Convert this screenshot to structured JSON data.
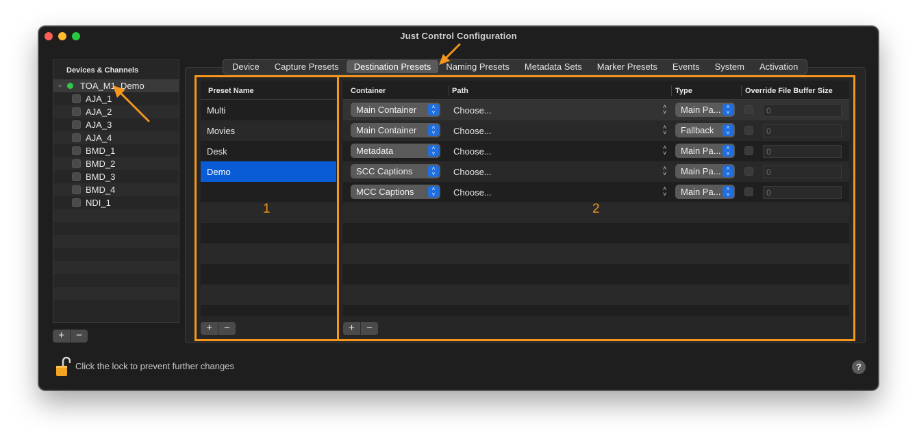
{
  "window": {
    "title": "Just Control Configuration"
  },
  "sidebar": {
    "header": "Devices & Channels",
    "device": {
      "label": "TOA_M1_Demo",
      "status_color": "#33c749"
    },
    "channels": [
      "AJA_1",
      "AJA_2",
      "AJA_3",
      "AJA_4",
      "BMD_1",
      "BMD_2",
      "BMD_3",
      "BMD_4",
      "NDI_1"
    ],
    "add_label": "+",
    "remove_label": "−"
  },
  "tabs": {
    "items": [
      "Device",
      "Capture Presets",
      "Destination Presets",
      "Naming Presets",
      "Metadata Sets",
      "Marker Presets",
      "Events",
      "System",
      "Activation"
    ],
    "active": "Destination Presets"
  },
  "presets": {
    "header": "Preset Name",
    "items": [
      "Multi",
      "Movies",
      "Desk",
      "Demo"
    ],
    "selected": "Demo",
    "add_label": "+",
    "remove_label": "−"
  },
  "containers": {
    "headers": {
      "container": "Container",
      "path": "Path",
      "type": "Type",
      "override": "Override File Buffer Size"
    },
    "rows": [
      {
        "container": "Main Container",
        "path": "Choose...",
        "type": "Main Pa...",
        "override_value": "0"
      },
      {
        "container": "Main Container",
        "path": "Choose...",
        "type": "Fallback",
        "override_value": "0"
      },
      {
        "container": "Metadata",
        "path": "Choose...",
        "type": "Main Pa...",
        "override_value": "0"
      },
      {
        "container": "SCC Captions",
        "path": "Choose...",
        "type": "Main Pa...",
        "override_value": "0"
      },
      {
        "container": "MCC Captions",
        "path": "Choose...",
        "type": "Main Pa...",
        "override_value": "0"
      }
    ],
    "add_label": "+",
    "remove_label": "−"
  },
  "annotations": {
    "label_1": "1",
    "label_2": "2",
    "color": "#f5961d"
  },
  "footer": {
    "lock_text": "Click the lock to prevent further changes",
    "help_label": "?"
  },
  "colors": {
    "selection": "#0a5cd6",
    "accent_stepper": "#1f6fe0"
  }
}
